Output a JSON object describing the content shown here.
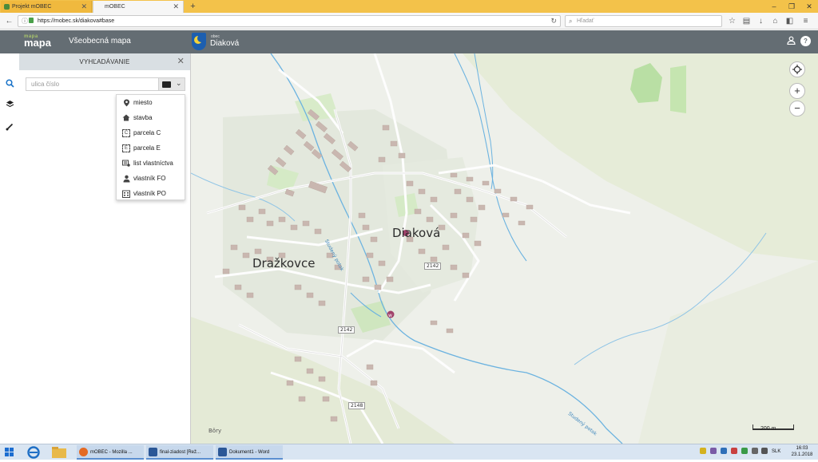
{
  "browser": {
    "tabs": [
      {
        "label": "Projekt mOBEC"
      },
      {
        "label": "mOBEC"
      }
    ],
    "url": "https://mobec.sk/diakova#base",
    "search_placeholder": "Hľadať"
  },
  "header": {
    "logo_top": "mapa",
    "logo": "mapa",
    "app_title": "Všeobecná mapa",
    "municipality_label": "obec",
    "municipality_name": "Diaková"
  },
  "panel": {
    "title": "VYHĽADÁVANIE",
    "search_placeholder": "ulica číslo"
  },
  "search_types": [
    {
      "label": "miesto",
      "icon": "location-pin-icon"
    },
    {
      "label": "stavba",
      "icon": "house-icon"
    },
    {
      "label": "parcela C",
      "icon": "parcel-c-icon"
    },
    {
      "label": "parcela E",
      "icon": "parcel-e-icon"
    },
    {
      "label": "list vlastníctva",
      "icon": "ownership-list-icon"
    },
    {
      "label": "vlastník FO",
      "icon": "person-icon"
    },
    {
      "label": "vlastník PO",
      "icon": "building-icon"
    }
  ],
  "map": {
    "labels": {
      "diakova": "Diaková",
      "drazkovce": "Dražkovce",
      "bory": "Bôry",
      "stream": "Studený potok",
      "stream2": "Studený potok",
      "road1": "2142",
      "road2": "2142",
      "road3": "2148"
    },
    "scale": "200 m"
  },
  "taskbar": {
    "apps": [
      {
        "label": "mOBEC - Mozilla ..."
      },
      {
        "label": "final-ziadost [Rež..."
      },
      {
        "label": "Dokument1 - Word"
      }
    ],
    "language": "SLK",
    "time": "16:03",
    "date": "23.1.2018"
  },
  "colors": {
    "app_header": "#646d73",
    "panel_header": "#d9dfe3",
    "tab_strip": "#f3c24a",
    "water": "#5aa8dc"
  }
}
